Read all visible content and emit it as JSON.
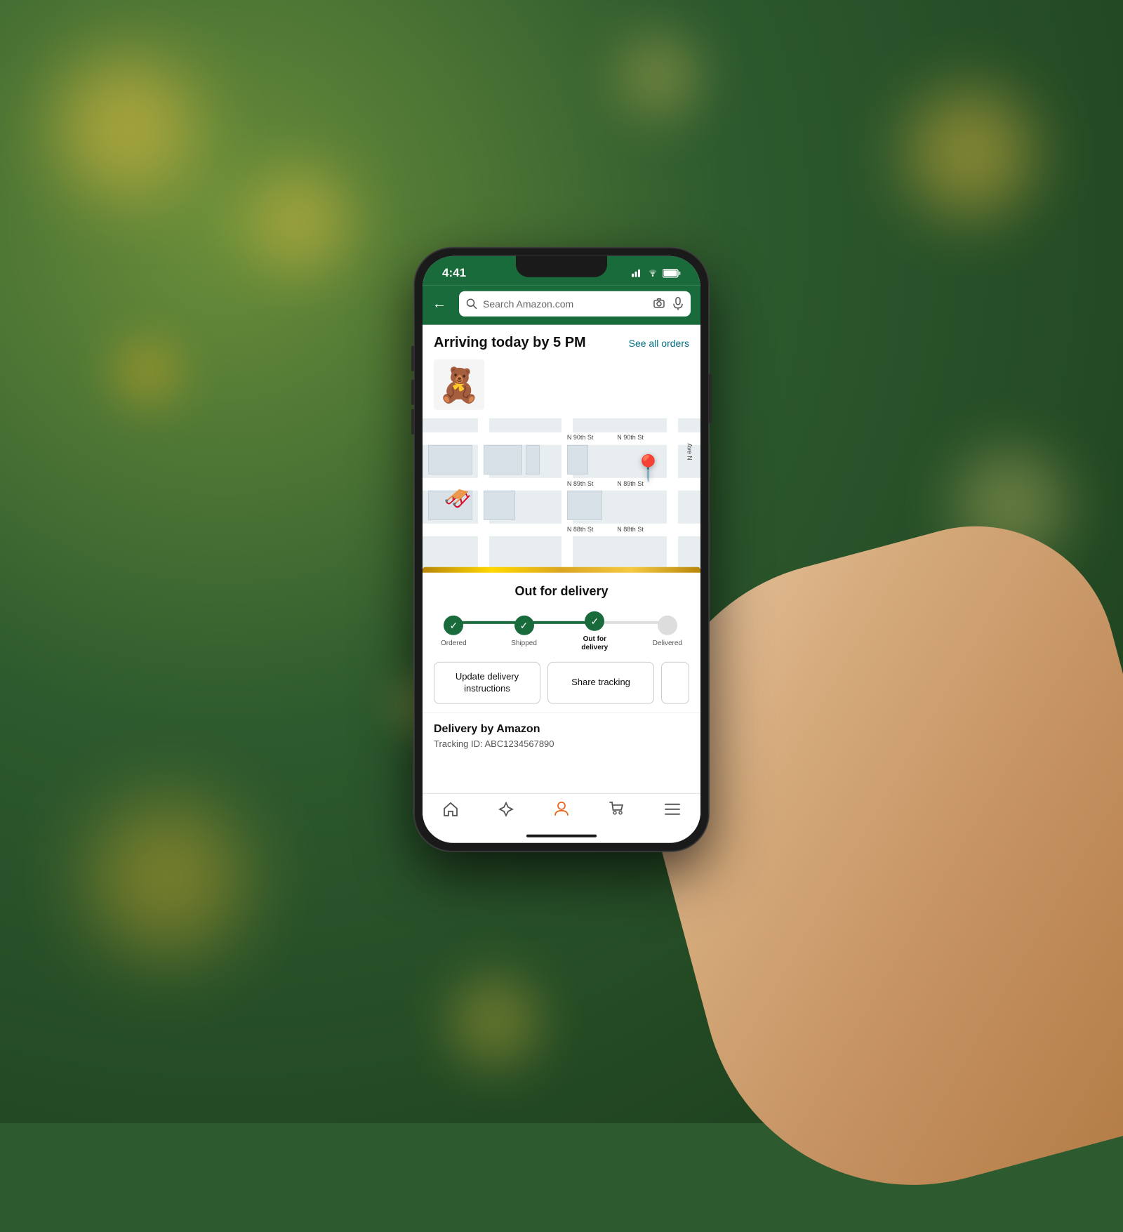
{
  "background": {
    "color": "#2d5a2e"
  },
  "status_bar": {
    "time": "4:41",
    "signal": "▄▆█",
    "wifi": "WiFi",
    "battery": "🔋"
  },
  "header": {
    "back_label": "←",
    "search_placeholder": "Search Amazon.com"
  },
  "arriving": {
    "title": "Arriving today by 5 PM",
    "see_all": "See all orders"
  },
  "product": {
    "emoji": "🧸"
  },
  "delivery_status": {
    "card_title": "Out for delivery",
    "steps": [
      {
        "label": "Ordered",
        "state": "done"
      },
      {
        "label": "Shipped",
        "state": "done"
      },
      {
        "label": "Out for\ndelivery",
        "state": "done",
        "bold": true
      },
      {
        "label": "Delivered",
        "state": "empty"
      }
    ]
  },
  "action_buttons": {
    "update_delivery": "Update delivery instructions",
    "share_tracking": "Share tracking"
  },
  "delivery_info": {
    "by_label": "Delivery by Amazon",
    "tracking_label": "Tracking ID: ABC1234567890"
  },
  "bottom_nav": {
    "items": [
      {
        "icon": "🏠",
        "label": "Home"
      },
      {
        "icon": "✦",
        "label": "Explore"
      },
      {
        "icon": "👤",
        "label": "Account",
        "active": true
      },
      {
        "icon": "🛒",
        "label": "Cart"
      },
      {
        "icon": "☰",
        "label": "Menu"
      }
    ]
  }
}
